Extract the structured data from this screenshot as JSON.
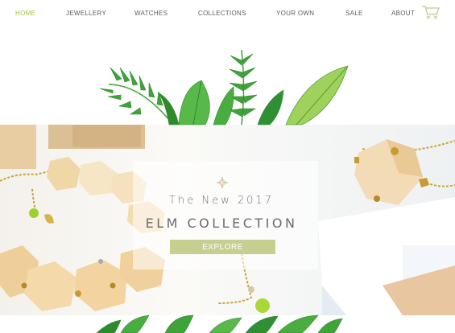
{
  "nav": {
    "items": [
      {
        "label": "HOME",
        "active": true
      },
      {
        "label": "JEWELLERY",
        "active": false
      },
      {
        "label": "WATCHES",
        "active": false
      },
      {
        "label": "COLLECTIONS",
        "active": false
      },
      {
        "label": "YOUR OWN",
        "active": false
      },
      {
        "label": "SALE",
        "active": false
      },
      {
        "label": "ABOUT",
        "active": false
      }
    ],
    "cart_icon": "shopping-cart-icon",
    "active_color": "#9cc53b"
  },
  "hero": {
    "emblem_icon": "compass-star-icon",
    "subtitle": "The New 2017",
    "title": "ELM COLLECTION",
    "button_label": "EXPLORE",
    "button_color": "#c6cf8f",
    "leaf_color": "#3fa33a"
  }
}
